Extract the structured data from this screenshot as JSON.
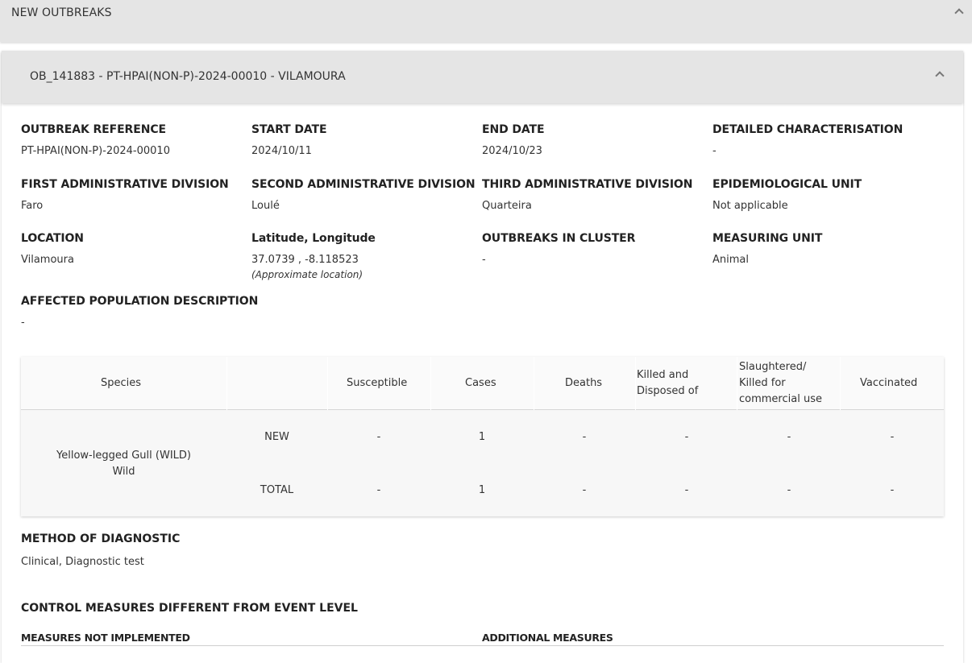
{
  "section": {
    "title": "NEW OUTBREAKS"
  },
  "outbreak": {
    "header": "OB_141883 - PT-HPAI(NON-P)-2024-00010 - VILAMOURA",
    "fields": {
      "outbreak_reference": {
        "label": "OUTBREAK REFERENCE",
        "value": "PT-HPAI(NON-P)-2024-00010"
      },
      "start_date": {
        "label": "START DATE",
        "value": "2024/10/11"
      },
      "end_date": {
        "label": "END DATE",
        "value": "2024/10/23"
      },
      "detailed_characterisation": {
        "label": "DETAILED CHARACTERISATION",
        "value": "-"
      },
      "first_admin": {
        "label": "FIRST ADMINISTRATIVE DIVISION",
        "value": "Faro"
      },
      "second_admin": {
        "label": "SECOND ADMINISTRATIVE DIVISION",
        "value": "Loulé"
      },
      "third_admin": {
        "label": "THIRD ADMINISTRATIVE DIVISION",
        "value": "Quarteira"
      },
      "epi_unit": {
        "label": "EPIDEMIOLOGICAL UNIT",
        "value": "Not applicable"
      },
      "location": {
        "label": "LOCATION",
        "value": "Vilamoura"
      },
      "latlong": {
        "label": "Latitude, Longitude",
        "value": "37.0739 , -8.118523",
        "note": "(Approximate location)"
      },
      "outbreaks_in_cluster": {
        "label": "OUTBREAKS IN CLUSTER",
        "value": "-"
      },
      "measuring_unit": {
        "label": "MEASURING UNIT",
        "value": "Animal"
      },
      "affected_population": {
        "label": "AFFECTED POPULATION DESCRIPTION",
        "value": "-"
      }
    },
    "table": {
      "headers": {
        "species": "Species",
        "susceptible": "Susceptible",
        "cases": "Cases",
        "deaths": "Deaths",
        "killed_line1": "Killed and",
        "killed_line2": "Disposed of",
        "slaughtered_line1": "Slaughtered/",
        "slaughtered_line2": "Killed for",
        "slaughtered_line3": "commercial use",
        "vaccinated": "Vaccinated"
      },
      "species_name": "Yellow-legged Gull (WILD)",
      "species_type": "Wild",
      "rows": [
        {
          "kind": "NEW",
          "susceptible": "-",
          "cases": "1",
          "deaths": "-",
          "killed": "-",
          "slaughtered": "-",
          "vaccinated": "-"
        },
        {
          "kind": "TOTAL",
          "susceptible": "-",
          "cases": "1",
          "deaths": "-",
          "killed": "-",
          "slaughtered": "-",
          "vaccinated": "-"
        }
      ]
    },
    "method_of_diagnostic": {
      "label": "METHOD OF DIAGNOSTIC",
      "value": "Clinical, Diagnostic test"
    },
    "control_measures": {
      "title": "CONTROL MEASURES DIFFERENT FROM EVENT LEVEL",
      "not_implemented": "MEASURES NOT IMPLEMENTED",
      "additional": "ADDITIONAL MEASURES"
    }
  }
}
